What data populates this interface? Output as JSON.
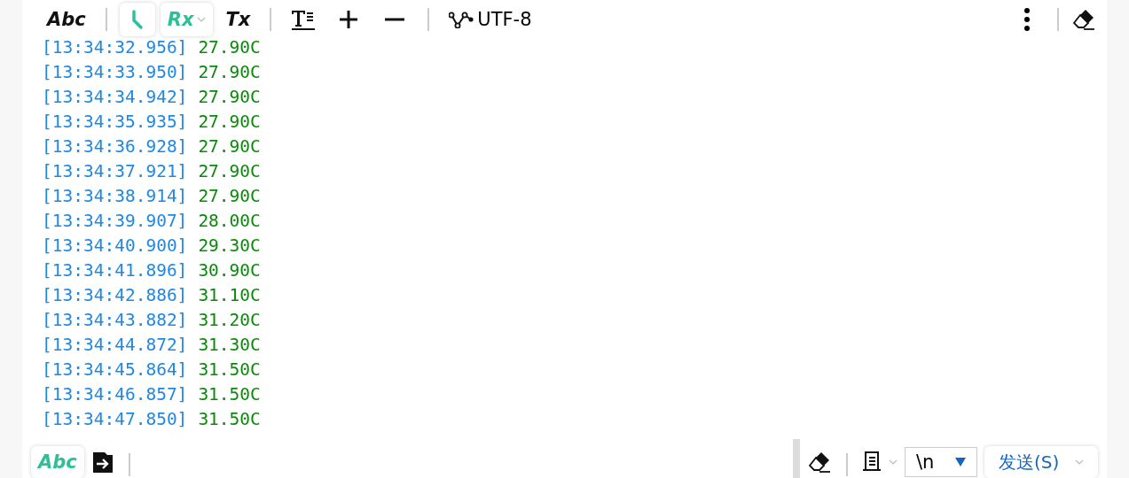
{
  "toolbar": {
    "left": [
      {
        "kind": "text",
        "label": "Abc",
        "on": false
      },
      {
        "kind": "sep"
      },
      {
        "kind": "timestamp",
        "on": true
      },
      {
        "kind": "dropdown",
        "label": "Rx",
        "on": true
      },
      {
        "kind": "text",
        "label": "Tx",
        "on": false
      },
      {
        "kind": "sep"
      },
      {
        "kind": "format"
      },
      {
        "kind": "plus"
      },
      {
        "kind": "minus"
      },
      {
        "kind": "sep"
      },
      {
        "kind": "encoding",
        "label": "UTF-8"
      }
    ],
    "right": [
      {
        "kind": "more"
      },
      {
        "kind": "sep"
      },
      {
        "kind": "eraser"
      }
    ]
  },
  "log": [
    {
      "time": "[13:34:32.956]",
      "value": "27.90C"
    },
    {
      "time": "[13:34:33.950]",
      "value": "27.90C"
    },
    {
      "time": "[13:34:34.942]",
      "value": "27.90C"
    },
    {
      "time": "[13:34:35.935]",
      "value": "27.90C"
    },
    {
      "time": "[13:34:36.928]",
      "value": "27.90C"
    },
    {
      "time": "[13:34:37.921]",
      "value": "27.90C"
    },
    {
      "time": "[13:34:38.914]",
      "value": "27.90C"
    },
    {
      "time": "[13:34:39.907]",
      "value": "28.00C"
    },
    {
      "time": "[13:34:40.900]",
      "value": "29.30C"
    },
    {
      "time": "[13:34:41.896]",
      "value": "30.90C"
    },
    {
      "time": "[13:34:42.886]",
      "value": "31.10C"
    },
    {
      "time": "[13:34:43.882]",
      "value": "31.20C"
    },
    {
      "time": "[13:34:44.872]",
      "value": "31.30C"
    },
    {
      "time": "[13:34:45.864]",
      "value": "31.50C"
    },
    {
      "time": "[13:34:46.857]",
      "value": "31.50C"
    },
    {
      "time": "[13:34:47.850]",
      "value": "31.50C"
    }
  ],
  "send_bar": {
    "text_mode": {
      "label": "Abc",
      "on": true
    },
    "line_ending": "\\n",
    "send_label": "发送(S)"
  }
}
